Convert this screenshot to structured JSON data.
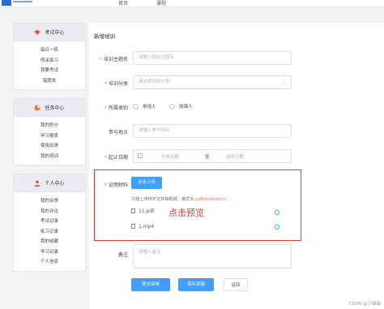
{
  "topbar": {
    "nav1": "首页",
    "nav2": "课程"
  },
  "sidebar": [
    {
      "title": "考试中心",
      "icon": "graduation-cap-icon",
      "color": "#e8533c",
      "items": [
        "每日一练",
        "闯关练习",
        "我要考试",
        "错题本"
      ]
    },
    {
      "title": "任务中心",
      "icon": "pie-chart-icon",
      "color": "#f07b2c",
      "items": [
        "我的积分",
        "学习报表",
        "使用反馈",
        "我的培训"
      ]
    },
    {
      "title": "个人中心",
      "icon": "person-icon",
      "color": "#e8533c",
      "items": [
        "我的反馈",
        "我的评论",
        "考试记录",
        "练习记录",
        "我的收藏",
        "学习记录",
        "个人信息"
      ]
    }
  ],
  "form": {
    "title": "新增培训",
    "theme": {
      "label": "培训主题名",
      "placeholder": "请输入培训主题名"
    },
    "category": {
      "label": "培训分类",
      "placeholder": "请选择培训分类"
    },
    "role": {
      "label": "所属类别",
      "options": [
        "参培人",
        "授课人"
      ]
    },
    "location": {
      "label": "参与地点",
      "placeholder": "请输入参与地点"
    },
    "dates": {
      "label": "起止日期",
      "start": "开始日期",
      "sep": "至",
      "end": "结束日期"
    },
    "proof": {
      "label": "证明材料",
      "upload": "点击上传",
      "tip_prefix": "只能上传PDF文件和视频，格式为 ",
      "tip_formats": "pdf/mp4/avi/ts",
      "files": [
        "11.pdf",
        "1.mp4"
      ],
      "annotation": "点击预览"
    },
    "remark": {
      "label": "备注",
      "placeholder": "请输入备注"
    },
    "buttons": {
      "submit": "提交审核",
      "draft": "保存草稿",
      "back": "返回"
    }
  },
  "watermark": "CSDN @小曲曲",
  "colors": {
    "primary": "#409eff",
    "danger": "#e53935",
    "required": "#f56c6c"
  }
}
